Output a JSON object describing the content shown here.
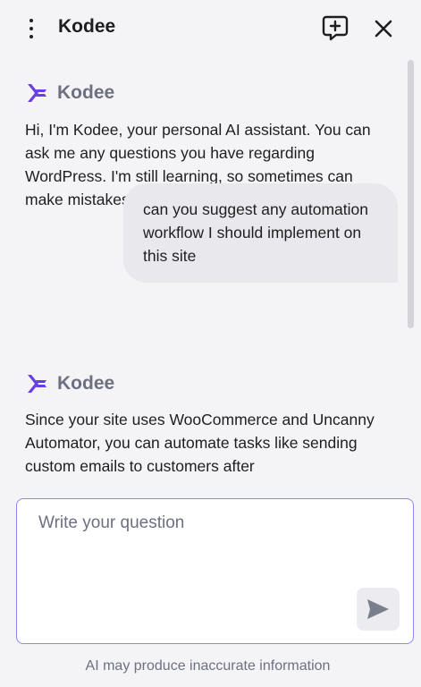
{
  "header": {
    "title": "Kodee",
    "menu_icon": "kebab-menu-icon",
    "new_chat_icon": "new-chat-icon",
    "close_icon": "close-icon"
  },
  "messages": [
    {
      "role": "assistant",
      "name": "Kodee",
      "text": "Hi, I'm Kodee, your personal AI assistant. You can ask me any questions you have regarding WordPress. I'm still learning, so sometimes can make mistakes. What questions do you have?"
    },
    {
      "role": "user",
      "text": "can you suggest any automation workflow I should implement on this site"
    },
    {
      "role": "assistant",
      "name": "Kodee",
      "text": "Since your site uses WooCommerce and Uncanny Automator, you can automate tasks like sending custom emails to customers after"
    }
  ],
  "composer": {
    "placeholder": "Write your question",
    "value": "",
    "send_icon": "send-icon"
  },
  "footer": {
    "disclaimer": "AI may produce inaccurate information"
  },
  "colors": {
    "background": "#f4f4f6",
    "accent": "#673de6",
    "input_border": "#8c85ff",
    "text": "#1d1e20",
    "muted": "#6d7081"
  }
}
